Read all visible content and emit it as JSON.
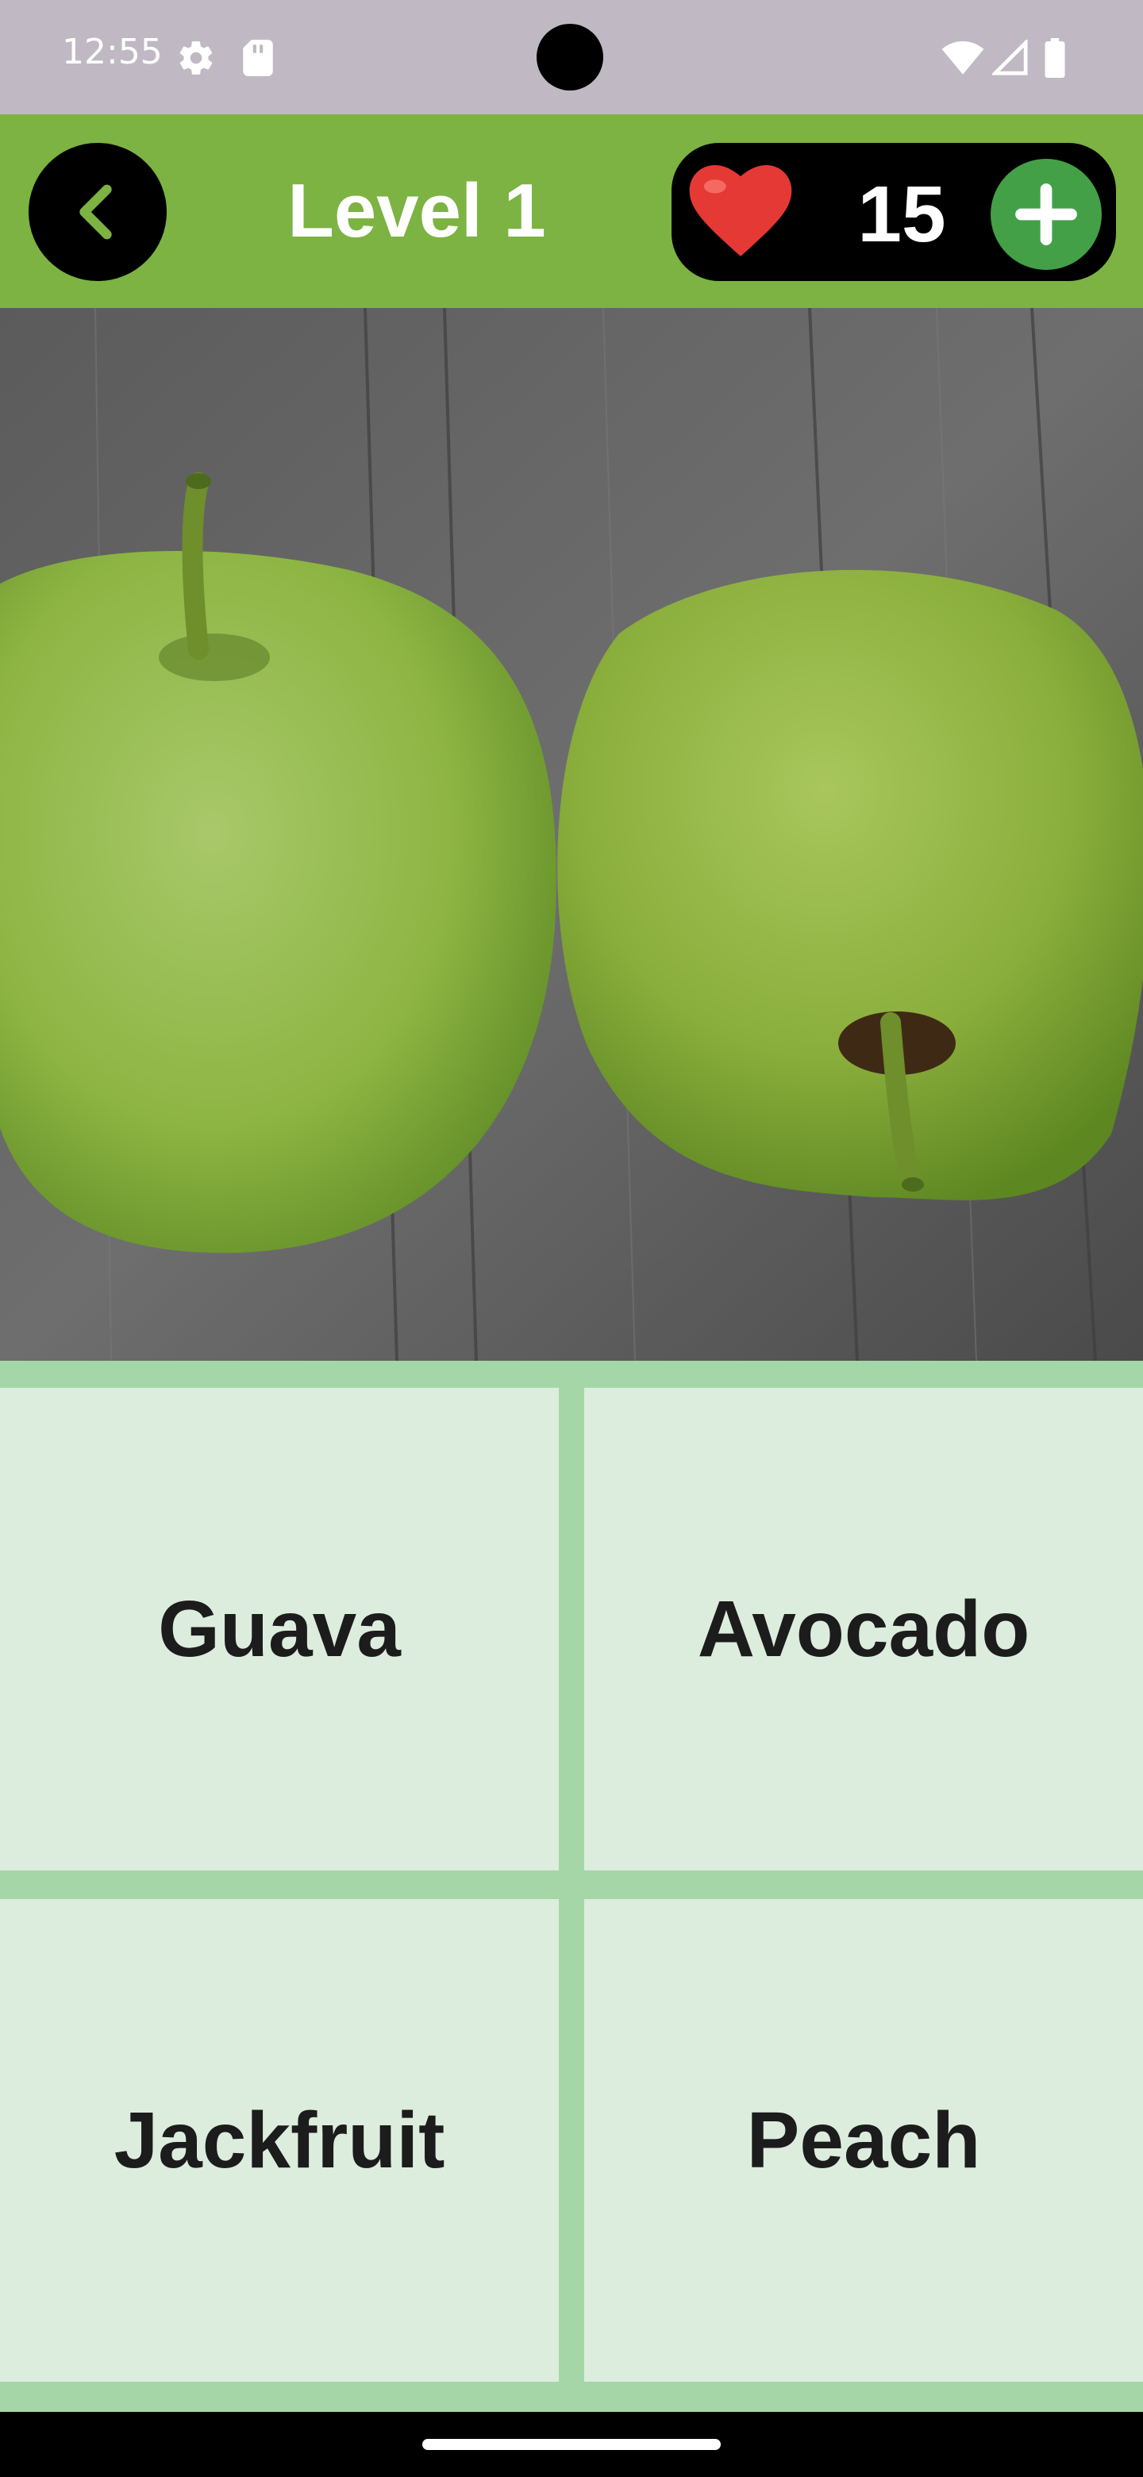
{
  "status_bar": {
    "time": "12:55",
    "icons": [
      "gear-icon",
      "sd-card-icon",
      "wifi-icon",
      "signal-icon",
      "battery-icon"
    ]
  },
  "header": {
    "back_icon": "chevron-left-icon",
    "title": "Level 1",
    "lives": {
      "icon": "heart-icon",
      "count": "15",
      "add_icon": "plus-icon"
    }
  },
  "question": {
    "image": "guava-fruits-photo"
  },
  "answers": [
    {
      "label": "Guava"
    },
    {
      "label": "Avocado"
    },
    {
      "label": "Jackfruit"
    },
    {
      "label": "Peach"
    }
  ],
  "colors": {
    "app_bar": "#7cb342",
    "status_bar": "#c0b8c3",
    "answer_background": "#dcedde",
    "grid_lines": "#a5d6a7",
    "add_button": "#43a047",
    "heart": "#e53935"
  }
}
